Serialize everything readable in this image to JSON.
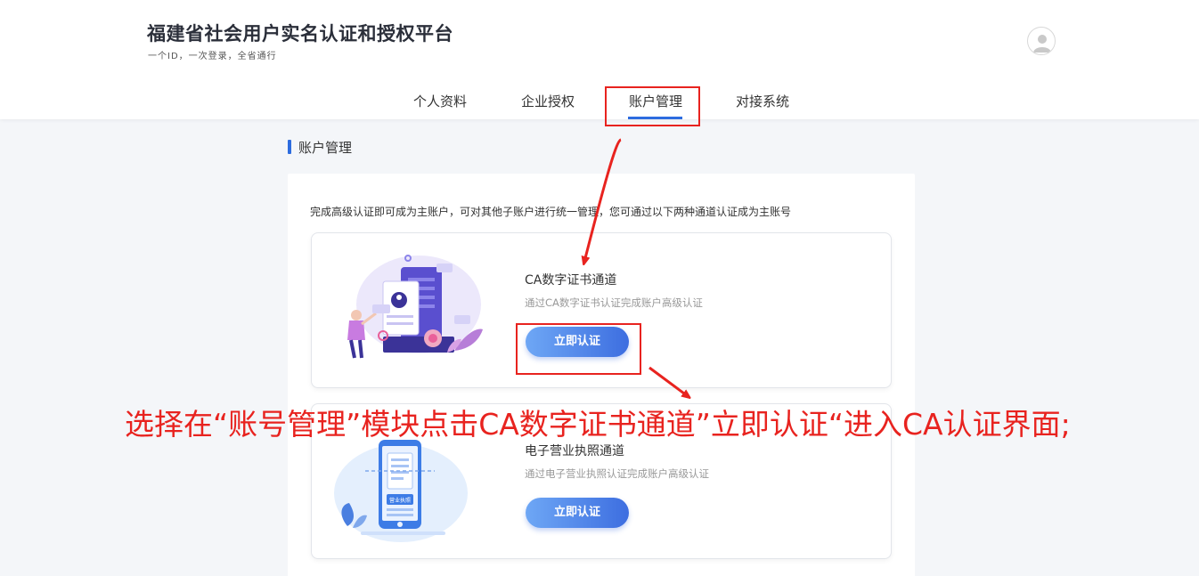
{
  "header": {
    "title": "福建省社会用户实名认证和授权平台",
    "slogan": "一个ID，一次登录，全省通行"
  },
  "nav": {
    "items": [
      {
        "label": "个人资料"
      },
      {
        "label": "企业授权"
      },
      {
        "label": "账户管理"
      },
      {
        "label": "对接系统"
      }
    ],
    "active_index": 2
  },
  "section": {
    "title": "账户管理"
  },
  "panel": {
    "description": "完成高级认证即可成为主账户，可对其他子账户进行统一管理，您可通过以下两种通道认证成为主账号"
  },
  "cards": [
    {
      "title": "CA数字证书通道",
      "subtitle": "通过CA数字证书认证完成账户高级认证",
      "button": "立即认证"
    },
    {
      "title": "电子营业执照通道",
      "subtitle": "通过电子营业执照认证完成账户高级认证",
      "button": "立即认证",
      "illustration_label": "营业执照"
    }
  ],
  "annotation": {
    "text": "选择在“账号管理”模块点击CA数字证书通道”立即认证“进入CA认证界面;"
  },
  "colors": {
    "accent": "#2d6cdf",
    "annotation_red": "#e8231f",
    "button_gradient_start": "#6ea7f5",
    "button_gradient_end": "#3d6ee0"
  },
  "icons": {
    "avatar": "user-avatar-icon"
  }
}
